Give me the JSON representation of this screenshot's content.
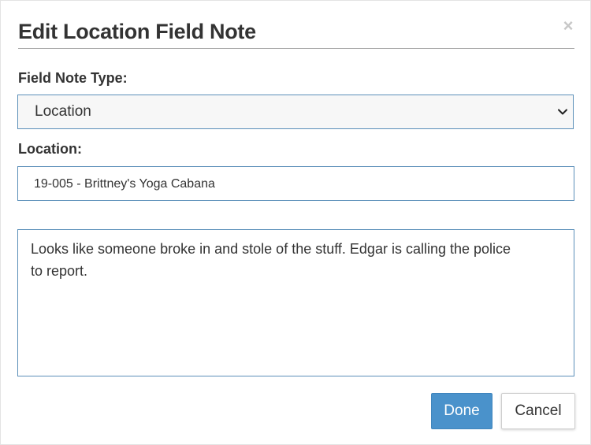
{
  "dialog": {
    "title": "Edit Location Field Note",
    "close_icon": "close-icon",
    "close_glyph": "×"
  },
  "field_note_type": {
    "label": "Field Note Type:",
    "selected": "Location",
    "caret_icon": "chevron-down-icon"
  },
  "location": {
    "label": "Location:",
    "value": "19-005 - Brittney's Yoga Cabana"
  },
  "note": {
    "text": "Looks like someone broke in and stole of the stuff. Edgar is calling the police to report."
  },
  "actions": {
    "done_label": "Done",
    "cancel_label": "Cancel"
  },
  "colors": {
    "primary": "#4a92cb",
    "border_accent": "#5b8fb9",
    "text": "#333333"
  }
}
